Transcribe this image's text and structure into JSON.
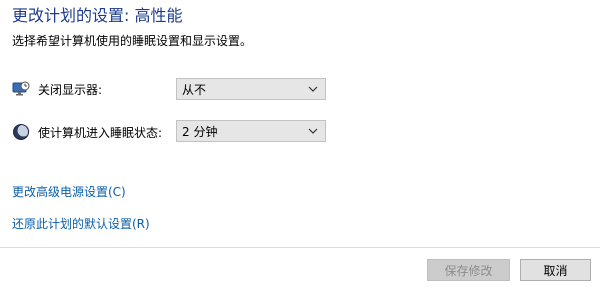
{
  "page": {
    "title": "更改计划的设置: 高性能",
    "subtitle": "选择希望计算机使用的睡眠设置和显示设置。"
  },
  "settings": {
    "display_off": {
      "label": "关闭显示器:",
      "value": "从不",
      "icon": "monitor-clock-icon"
    },
    "sleep": {
      "label": "使计算机进入睡眠状态:",
      "value": "2 分钟",
      "icon": "moon-icon"
    }
  },
  "links": {
    "advanced": "更改高级电源设置(C)",
    "restore": "还原此计划的默认设置(R)"
  },
  "buttons": {
    "save": "保存修改",
    "cancel": "取消"
  },
  "colors": {
    "title": "#1e3c8c",
    "link": "#0b5ea8",
    "select_bg": "#e6e6e6",
    "disabled_button": "#cccccc"
  }
}
